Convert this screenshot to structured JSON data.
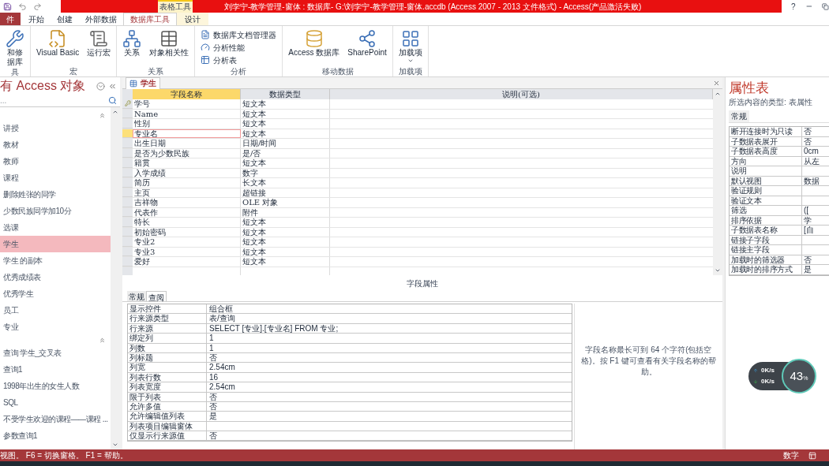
{
  "title_bar": {
    "context_tab": "表格工具",
    "title": "刘孛宁-教学管理-窗体 : 数据库- G:\\刘孛宁-教学管理-窗体.accdb (Access 2007 - 2013 文件格式) -  Access(产品激活失败)",
    "help": "?"
  },
  "ribbon_tabs": [
    {
      "label": "件",
      "kind": "file",
      "selected": false
    },
    {
      "label": "开始",
      "kind": "normal",
      "selected": false
    },
    {
      "label": "创建",
      "kind": "normal",
      "selected": false
    },
    {
      "label": "外部数据",
      "kind": "normal",
      "selected": false
    },
    {
      "label": "数据库工具",
      "kind": "normal",
      "selected": true
    },
    {
      "label": "设计",
      "kind": "context",
      "selected": false
    }
  ],
  "ribbon_groups": [
    {
      "label": "具",
      "buttons": [
        {
          "kind": "large",
          "lines": [
            "和修",
            "据库"
          ]
        }
      ]
    },
    {
      "label": "宏",
      "buttons": [
        {
          "kind": "large",
          "lines": [
            "Visual Basic"
          ]
        },
        {
          "kind": "large",
          "lines": [
            "运行宏"
          ]
        }
      ]
    },
    {
      "label": "关系",
      "buttons": [
        {
          "kind": "large",
          "lines": [
            "关系"
          ]
        },
        {
          "kind": "large",
          "lines": [
            "对象相关性"
          ]
        }
      ]
    },
    {
      "label": "分析",
      "buttons": [
        {
          "kind": "small",
          "lines": [
            "数据库文档管理器"
          ]
        },
        {
          "kind": "small",
          "lines": [
            "分析性能"
          ]
        },
        {
          "kind": "small",
          "lines": [
            "分析表"
          ]
        }
      ]
    },
    {
      "label": "移动数据",
      "buttons": [
        {
          "kind": "large",
          "lines": [
            "Access 数据库"
          ]
        },
        {
          "kind": "large",
          "lines": [
            "SharePoint"
          ]
        }
      ]
    },
    {
      "label": "加载项",
      "buttons": [
        {
          "kind": "large",
          "lines": [
            "加载项"
          ],
          "dropdown": true
        }
      ]
    }
  ],
  "nav_pane": {
    "title": "有 Access 对象",
    "search_placeholder": "...",
    "groups": [
      {
        "expanded": true,
        "items": [
          {
            "label": "讲授",
            "selected": false
          },
          {
            "label": "教材",
            "selected": false
          },
          {
            "label": "教师",
            "selected": false
          },
          {
            "label": "课程",
            "selected": false
          },
          {
            "label": "删除姓张的同学",
            "selected": false
          },
          {
            "label": "少数民族同学加10分",
            "selected": false
          },
          {
            "label": "选课",
            "selected": false
          },
          {
            "label": "学生",
            "selected": true
          },
          {
            "label": "学生 的副本",
            "selected": false
          },
          {
            "label": "优秀成绩表",
            "selected": false
          },
          {
            "label": "优秀学生",
            "selected": false
          },
          {
            "label": "员工",
            "selected": false
          },
          {
            "label": "专业",
            "selected": false
          }
        ]
      },
      {
        "expanded": true,
        "items": [
          {
            "label": "查询 学生_交叉表",
            "selected": false
          },
          {
            "label": "查询1",
            "selected": false
          },
          {
            "label": "1998年出生的女生人数",
            "selected": false
          },
          {
            "label": "SQL",
            "selected": false
          },
          {
            "label": "不受学生欢迎的课程——课程 ...",
            "selected": false
          },
          {
            "label": "参数查询1",
            "selected": false
          }
        ]
      }
    ]
  },
  "document": {
    "tab": "学生",
    "columns": [
      {
        "label": "字段名称",
        "selected": true
      },
      {
        "label": "数据类型",
        "selected": false
      },
      {
        "label": "说明(可选)",
        "selected": false
      }
    ],
    "fields": [
      {
        "name": "学号",
        "type": "短文本",
        "primary_key": true,
        "current": false
      },
      {
        "name": "Name",
        "type": "短文本",
        "primary_key": false,
        "current": false
      },
      {
        "name": "性别",
        "type": "短文本",
        "primary_key": false,
        "current": false
      },
      {
        "name": "专业名",
        "type": "短文本",
        "primary_key": false,
        "current": true
      },
      {
        "name": "出生日期",
        "type": "日期/时间",
        "primary_key": false,
        "current": false
      },
      {
        "name": "是否为少数民族",
        "type": "是/否",
        "primary_key": false,
        "current": false
      },
      {
        "name": "籍贯",
        "type": "短文本",
        "primary_key": false,
        "current": false
      },
      {
        "name": "入学成绩",
        "type": "数字",
        "primary_key": false,
        "current": false
      },
      {
        "name": "简历",
        "type": "长文本",
        "primary_key": false,
        "current": false
      },
      {
        "name": "主页",
        "type": "超链接",
        "primary_key": false,
        "current": false
      },
      {
        "name": "吉祥物",
        "type": "OLE 对象",
        "primary_key": false,
        "current": false
      },
      {
        "name": "代表作",
        "type": "附件",
        "primary_key": false,
        "current": false
      },
      {
        "name": "特长",
        "type": "短文本",
        "primary_key": false,
        "current": false
      },
      {
        "name": "初始密码",
        "type": "短文本",
        "primary_key": false,
        "current": false
      },
      {
        "name": "专业2",
        "type": "短文本",
        "primary_key": false,
        "current": false
      },
      {
        "name": "专业3",
        "type": "短文本",
        "primary_key": false,
        "current": false
      },
      {
        "name": "爱好",
        "type": "短文本",
        "primary_key": false,
        "current": false
      }
    ],
    "section_label": "字段属性",
    "property_tabs": [
      {
        "label": "常规",
        "selected": false
      },
      {
        "label": "查阅",
        "selected": true
      }
    ],
    "properties": [
      {
        "name": "显示控件",
        "value": "组合框"
      },
      {
        "name": "行来源类型",
        "value": "表/查询"
      },
      {
        "name": "行来源",
        "value": "SELECT [专业].[专业名] FROM 专业;"
      },
      {
        "name": "绑定列",
        "value": "1"
      },
      {
        "name": "列数",
        "value": "1"
      },
      {
        "name": "列标题",
        "value": "否"
      },
      {
        "name": "列宽",
        "value": "2.54cm"
      },
      {
        "name": "列表行数",
        "value": "16"
      },
      {
        "name": "列表宽度",
        "value": "2.54cm"
      },
      {
        "name": "限于列表",
        "value": "否"
      },
      {
        "name": "允许多值",
        "value": "否"
      },
      {
        "name": "允许编辑值列表",
        "value": "是"
      },
      {
        "name": "列表项目编辑窗体"
      },
      {
        "name": "仅显示行来源值",
        "value": "否"
      }
    ],
    "help_text": "字段名称最长可到 64 个字符(包括空格)。按 F1 键可查看有关字段名称的帮助。"
  },
  "property_sheet": {
    "title": "属性表",
    "selection_type": "所选内容的类型: 表属性",
    "tabs": [
      {
        "label": "常规",
        "selected": true
      }
    ],
    "properties": [
      {
        "name": "断开连接时为只读",
        "value": "否"
      },
      {
        "name": "子数据表展开",
        "value": "否"
      },
      {
        "name": "子数据表高度",
        "value": "0cm"
      },
      {
        "name": "方向",
        "value": "从左"
      },
      {
        "name": "说明"
      },
      {
        "name": "默认视图",
        "value": "数据"
      },
      {
        "name": "验证规则"
      },
      {
        "name": "验证文本"
      },
      {
        "name": "筛选",
        "value": "(["
      },
      {
        "name": "排序依据",
        "value": "学"
      },
      {
        "name": "子数据表名称",
        "value": "[自"
      },
      {
        "name": "链接子字段"
      },
      {
        "name": "链接主字段"
      },
      {
        "name": "加载时的筛选器",
        "value": "否"
      },
      {
        "name": "加载时的排序方式",
        "value": "是"
      }
    ]
  },
  "speed_widget": {
    "upload": "0K/s",
    "download": "0K/s",
    "percent": "43",
    "unit": "%"
  },
  "status_bar": {
    "message": "视图。 F6 = 切换窗格。 F1 = 帮助。",
    "indicator": "数字"
  }
}
